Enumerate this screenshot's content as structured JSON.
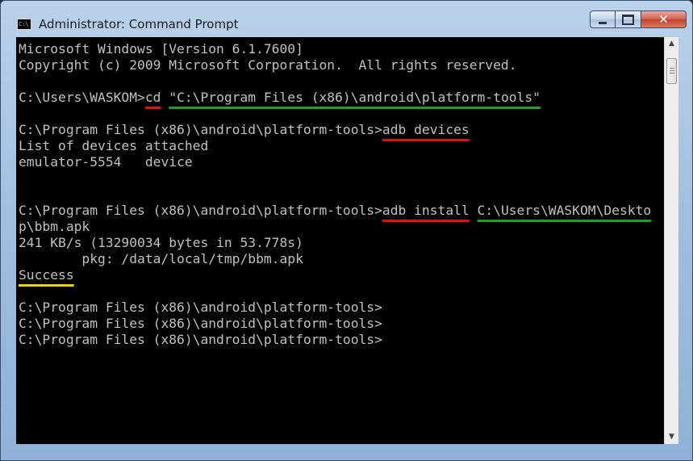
{
  "window": {
    "title": "Administrator: Command Prompt",
    "app_icon_text": "C:\\",
    "close_glyph": "✕"
  },
  "console": {
    "lines": [
      {
        "segments": [
          {
            "text": "Microsoft Windows [Version 6.1.7600]"
          }
        ]
      },
      {
        "segments": [
          {
            "text": "Copyright (c) 2009 Microsoft Corporation.  All rights reserved."
          }
        ]
      },
      {
        "segments": [
          {
            "text": ""
          }
        ]
      },
      {
        "segments": [
          {
            "text": "C:\\Users\\WASKOM>"
          },
          {
            "text": "cd",
            "mark": "red"
          },
          {
            "text": " "
          },
          {
            "text": "\"C:\\Program Files (x86)\\android\\platform-tools\"",
            "mark": "green"
          }
        ]
      },
      {
        "segments": [
          {
            "text": ""
          }
        ]
      },
      {
        "segments": [
          {
            "text": "C:\\Program Files (x86)\\android\\platform-tools>"
          },
          {
            "text": "adb devices",
            "mark": "red"
          }
        ]
      },
      {
        "segments": [
          {
            "text": "List of devices attached"
          }
        ]
      },
      {
        "segments": [
          {
            "text": "emulator-5554   device"
          }
        ]
      },
      {
        "segments": [
          {
            "text": ""
          }
        ]
      },
      {
        "segments": [
          {
            "text": ""
          }
        ]
      },
      {
        "segments": [
          {
            "text": "C:\\Program Files (x86)\\android\\platform-tools>"
          },
          {
            "text": "adb install",
            "mark": "red"
          },
          {
            "text": " "
          },
          {
            "text": "C:\\Users\\WASKOM\\Deskto",
            "mark": "green"
          }
        ]
      },
      {
        "segments": [
          {
            "text": "p\\bbm.apk"
          }
        ]
      },
      {
        "segments": [
          {
            "text": "241 KB/s (13290034 bytes in 53.778s)"
          }
        ]
      },
      {
        "segments": [
          {
            "text": "        pkg: /data/local/tmp/bbm.apk"
          }
        ]
      },
      {
        "segments": [
          {
            "text": "Success",
            "mark": "yellow"
          }
        ]
      },
      {
        "segments": [
          {
            "text": ""
          }
        ]
      },
      {
        "segments": [
          {
            "text": "C:\\Program Files (x86)\\android\\platform-tools>"
          }
        ]
      },
      {
        "segments": [
          {
            "text": "C:\\Program Files (x86)\\android\\platform-tools>"
          }
        ]
      },
      {
        "segments": [
          {
            "text": "C:\\Program Files (x86)\\android\\platform-tools>"
          }
        ]
      }
    ]
  },
  "scrollbar": {
    "up_glyph": "▲",
    "down_glyph": "▼"
  }
}
